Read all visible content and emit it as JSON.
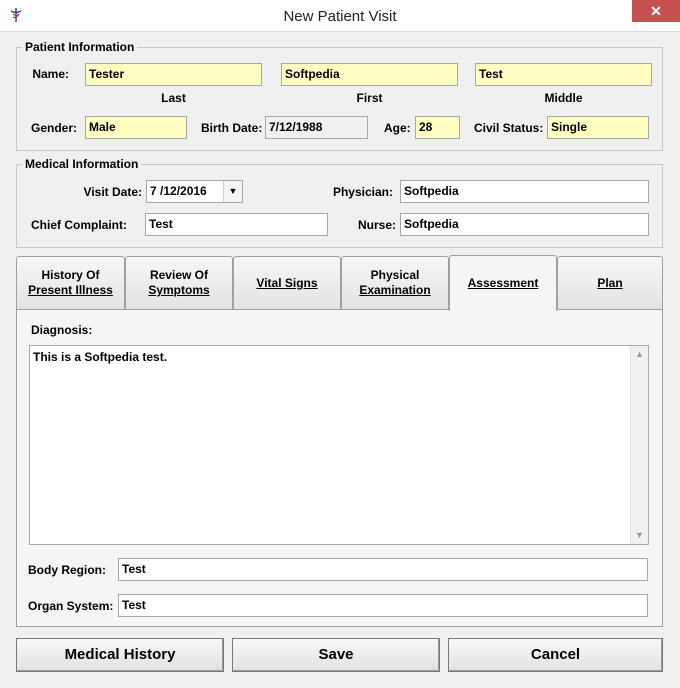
{
  "window": {
    "title": "New Patient Visit",
    "close_glyph": "✕",
    "icon": "caduceus-icon"
  },
  "patient_info": {
    "legend": "Patient Information",
    "name_label": "Name:",
    "last_value": "Tester",
    "first_value": "Softpedia",
    "middle_value": "Test",
    "last_caption": "Last",
    "first_caption": "First",
    "middle_caption": "Middle",
    "gender_label": "Gender:",
    "gender_value": "Male",
    "birth_label": "Birth Date:",
    "birth_value": "7/12/1988",
    "age_label": "Age:",
    "age_value": "28",
    "civil_label": "Civil Status:",
    "civil_value": "Single"
  },
  "medical_info": {
    "legend": "Medical Information",
    "visit_date_label": "Visit Date:",
    "visit_date_value": "7 /12/2016",
    "physician_label": "Physician:",
    "physician_value": "Softpedia",
    "complaint_label": "Chief Complaint:",
    "complaint_value": "Test",
    "nurse_label": "Nurse:",
    "nurse_value": "Softpedia"
  },
  "tabs": [
    {
      "line1": "History Of",
      "line2": "Present Illness"
    },
    {
      "line1": "Review Of",
      "line2": "Symptoms"
    },
    {
      "line1": "Vital Signs",
      "line2": ""
    },
    {
      "line1": "Physical",
      "line2": "Examination"
    },
    {
      "line1": "Assessment",
      "line2": ""
    },
    {
      "line1": "Plan",
      "line2": ""
    }
  ],
  "active_tab": "Assessment",
  "assessment": {
    "diagnosis_label": "Diagnosis:",
    "diagnosis_value": "This is a Softpedia test.",
    "body_region_label": "Body Region:",
    "body_region_value": "Test",
    "organ_system_label": "Organ System:",
    "organ_system_value": "Test"
  },
  "buttons": {
    "history": "Medical History",
    "save": "Save",
    "cancel": "Cancel"
  },
  "colors": {
    "required_field": "#ffffc4",
    "close_button": "#c75050"
  }
}
